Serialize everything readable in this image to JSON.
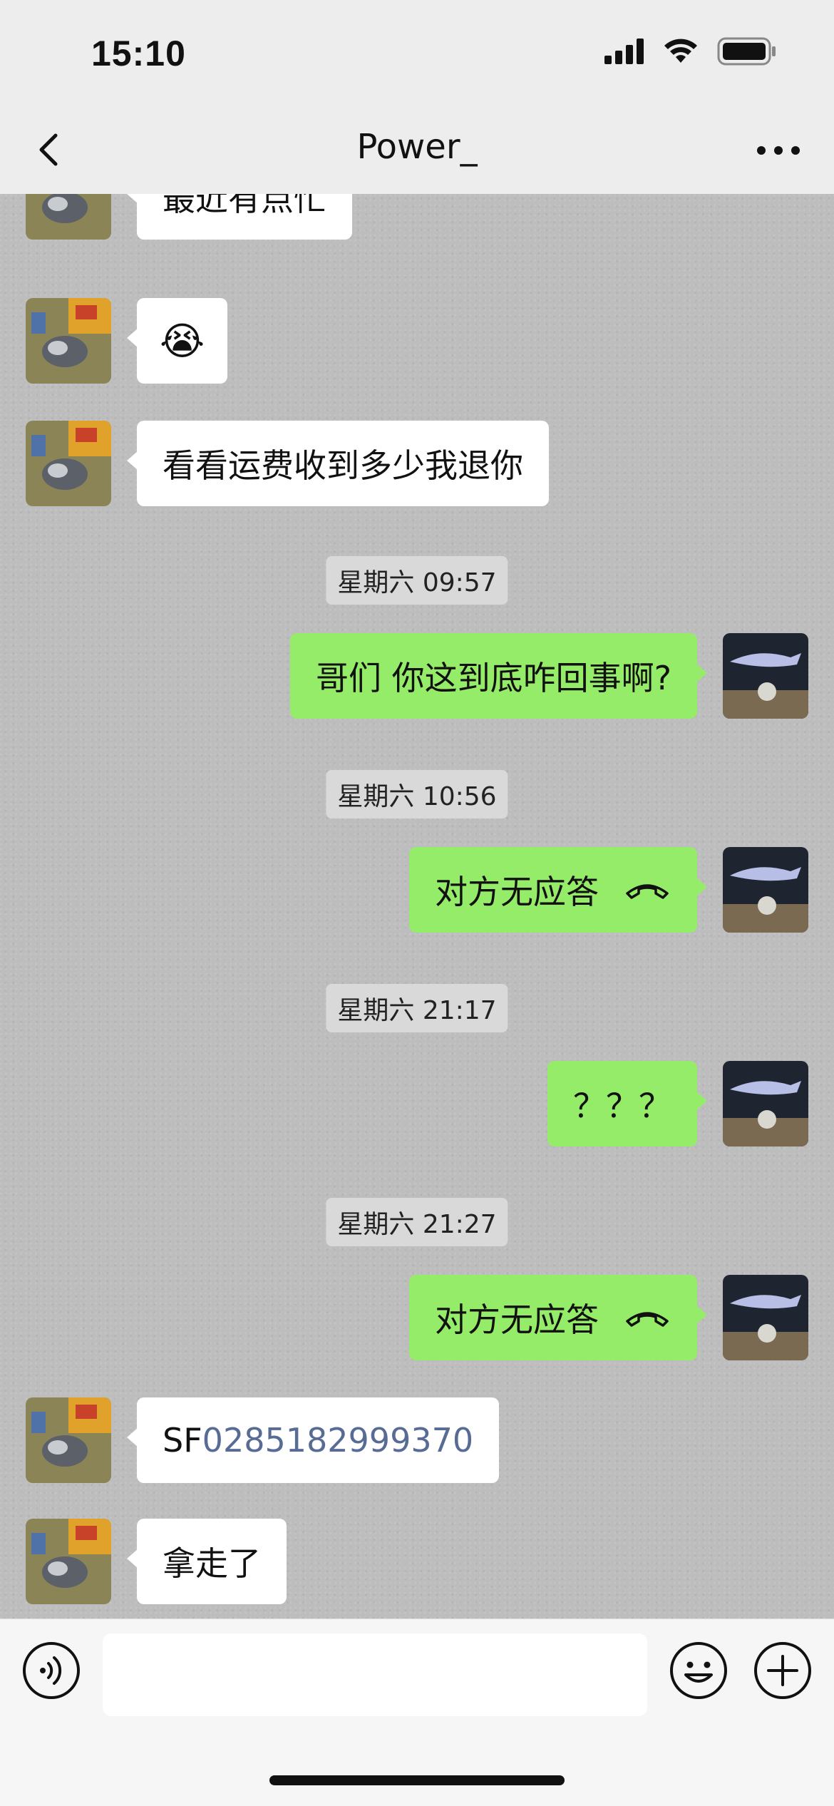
{
  "status_bar": {
    "time": "15:10"
  },
  "header": {
    "title": "Power_"
  },
  "messages": [
    {
      "side": "left",
      "text": "最近有点忙"
    },
    {
      "side": "left",
      "emoji": "😭"
    },
    {
      "side": "left",
      "text": "看看运费收到多少我退你"
    },
    {
      "timestamp": "星期六 09:57"
    },
    {
      "side": "right",
      "text": "哥们 你这到底咋回事啊?"
    },
    {
      "timestamp": "星期六 10:56"
    },
    {
      "side": "right",
      "text": "对方无应答",
      "icon": "hangup-phone-icon"
    },
    {
      "timestamp": "星期六 21:17"
    },
    {
      "side": "right",
      "text": "？？？"
    },
    {
      "timestamp": "星期六 21:27"
    },
    {
      "side": "right",
      "text": "对方无应答",
      "icon": "hangup-phone-icon"
    },
    {
      "side": "left",
      "prefix": "SF",
      "link": "0285182999370"
    },
    {
      "side": "left",
      "text": "拿走了"
    }
  ],
  "input": {
    "placeholder": ""
  },
  "colors": {
    "sent_bubble": "#95ec69",
    "received_bubble": "#ffffff",
    "link": "#576b95",
    "chat_bg": "#bdbdbd"
  }
}
